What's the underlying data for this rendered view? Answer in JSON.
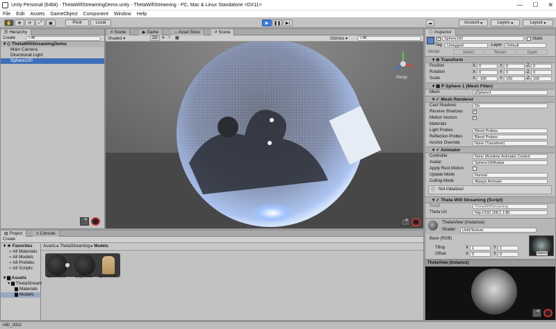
{
  "window": {
    "title": "Unity Personal (64bit) - ThetaWifiStreamingDemo.unity - ThetaWifiStreaming - PC, Mac & Linux Standalone <DX11>",
    "minimize": "—",
    "maximize": "☐",
    "close": "✕"
  },
  "menu": [
    "File",
    "Edit",
    "Assets",
    "GameObject",
    "Component",
    "Window",
    "Help"
  ],
  "toolbar": {
    "pivot": "Pivot",
    "local": "Local",
    "account": "Account",
    "layers": "Layers",
    "layout": "Layout"
  },
  "hierarchy": {
    "tab": "Hierarchy",
    "create": "Create",
    "search_placeholder": "All",
    "scene": "ThetaWifiStreamingDemo",
    "items": [
      "Main Camera",
      "Directional Light",
      "Sphere100"
    ]
  },
  "scene": {
    "tabs": [
      "Scene",
      "Game",
      "Asset Store",
      "Scene"
    ],
    "shading": "Shaded",
    "mode_2d": "2D",
    "gizmos": "Gizmos",
    "search_placeholder": "All",
    "persp": "Persp"
  },
  "project": {
    "tabs": [
      "Project",
      "Console"
    ],
    "create": "Create",
    "breadcrumb": [
      "Assets",
      "ThetaStreaming",
      "Models"
    ],
    "favorites_label": "Favorites",
    "favorites": [
      "All Materials",
      "All Models",
      "All Prefabs",
      "All Scripts"
    ],
    "assets_label": "Assets",
    "tree": [
      "ThetaStream",
      "Materials",
      "Models"
    ],
    "assets": [
      "Sphere100",
      "pSphere1",
      "Sphere100..."
    ]
  },
  "inspector": {
    "tab": "Inspector",
    "object_name": "Sphere100",
    "static": "Static",
    "tag_label": "Tag",
    "tag": "Untagged",
    "layer_label": "Layer",
    "layer": "Default",
    "model_label": "Model",
    "model_buttons": [
      "Select",
      "Revert",
      "Open"
    ],
    "transform": {
      "title": "Transform",
      "rows": [
        {
          "label": "Position",
          "x": "0",
          "y": "0",
          "z": "0"
        },
        {
          "label": "Rotation",
          "x": "0",
          "y": "0",
          "z": "0"
        },
        {
          "label": "Scale",
          "x": "-100",
          "y": "100",
          "z": "100"
        }
      ]
    },
    "mesh_filter": {
      "title": "P Sphere 1 (Mesh Filter)",
      "mesh_label": "Mesh",
      "mesh": "pSphere1"
    },
    "mesh_renderer": {
      "title": "Mesh Renderer",
      "rows": [
        {
          "label": "Cast Shadows",
          "value": "On"
        },
        {
          "label": "Receive Shadows",
          "value": "✓"
        },
        {
          "label": "Motion Vectors",
          "value": "✓"
        },
        {
          "label": "Materials",
          "value": ""
        },
        {
          "label": "Light Probes",
          "value": "Blend Probes"
        },
        {
          "label": "Reflection Probes",
          "value": "Blend Probes"
        },
        {
          "label": "Anchor Override",
          "value": "None (Transform)"
        }
      ]
    },
    "animator": {
      "title": "Animator",
      "rows": [
        {
          "label": "Controller",
          "value": "None (Runtime Animator Control"
        },
        {
          "label": "Avatar",
          "value": "Sphere100Avatar"
        },
        {
          "label": "Apply Root Motion",
          "value": ""
        },
        {
          "label": "Update Mode",
          "value": "Normal"
        },
        {
          "label": "Culling Mode",
          "value": "Always Animate"
        }
      ],
      "info": "Not initialized"
    },
    "script": {
      "title": "Theta Wifi Streaming (Script)",
      "script_label": "Script",
      "script": "ThetaWifiStreaming",
      "url_label": "Theta Url",
      "url": "http://192.168.1.1:80"
    },
    "material": {
      "name": "ThetaView (Instance)",
      "shader_label": "Shader",
      "shader": "Unlit/Texture",
      "base": "Base (RGB)",
      "tiling_label": "Tiling",
      "offset_label": "Offset",
      "tiling_x": "1",
      "tiling_y": "1",
      "offset_x": "0",
      "offset_y": "0",
      "select": "Select"
    },
    "preview_title": "ThetaView (Instance)"
  },
  "status": "HID_0002"
}
